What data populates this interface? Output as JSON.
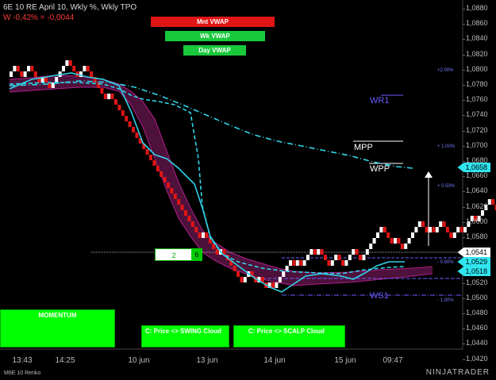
{
  "header": {
    "title": "6E 10 RE April 10, Wkly %, Wkly TPO",
    "change": "W -0,42% = -0,0044"
  },
  "vwap_buttons": [
    {
      "label": "Mnt VWAP",
      "color": "#e01515"
    },
    {
      "label": "Wk VWAP",
      "color": "#18c93c"
    },
    {
      "label": "Day VWAP",
      "color": "#18c93c"
    }
  ],
  "panels": {
    "momentum": "MOMENTUM",
    "swing": "C: Price <> SWING Cloud",
    "scalp": "C: Price <> SCALP Cloud"
  },
  "renko_counter": {
    "left": "2",
    "right": "6"
  },
  "levels": {
    "wr1": "WR1",
    "mpp": "MPP",
    "wpp": "WPP",
    "ws1": "WS1"
  },
  "pct_labels": {
    "p2": "+2.00%",
    "p1": "+ 1.00%",
    "p05": "+ 0.50%",
    "m05": "- 0.50%",
    "m1": "- 1.00%"
  },
  "y_axis": {
    "labels": [
      "1,0880",
      "1,0860",
      "1,0840",
      "1,0820",
      "1,0800",
      "1,0780",
      "1,0760",
      "1,0740",
      "1,0720",
      "1,0700",
      "1,0680",
      "1,0660",
      "1,0640",
      "1,0620",
      "1,0600",
      "1,0580",
      "1,0560",
      "1,0540",
      "1,0520",
      "1,0500",
      "1,0480",
      "1,0460",
      "1,0440",
      "1,0420"
    ],
    "tag_current": "1,0541",
    "tag_wpp": "1,0658",
    "tag_upper": "1,0529",
    "tag_lower": "1,0518"
  },
  "x_axis": {
    "labels": [
      "13:43",
      "14:25",
      "10 jun",
      "13 jun",
      "14 jun",
      "15 jun",
      "09:47"
    ]
  },
  "footer": {
    "instrument": "M6E 10 Renko",
    "brand": "NINJATRADER"
  },
  "colors": {
    "up_brick": "#ffffff",
    "down_brick": "#e01515",
    "vwap_line": "#2fd3e8",
    "cloud": "#5a1445",
    "pivot": "#6a5cff",
    "wpp_tag": "#2fe6f0"
  }
}
